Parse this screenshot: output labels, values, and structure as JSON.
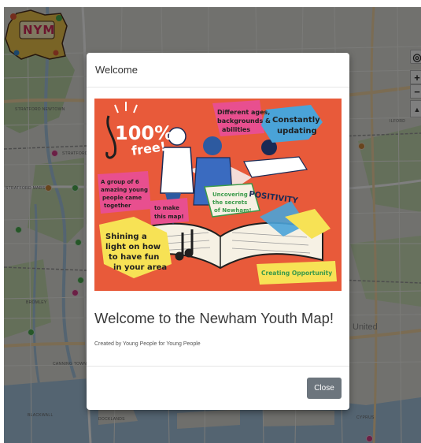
{
  "logo": {
    "text": "NYM"
  },
  "map": {
    "labels": {
      "stratford_newtown": "STRATFORD NEWTOWN",
      "stratford": "STRATFORD",
      "stratford_marsh": "STRATFORD MARSH",
      "bromley": "BROMLEY",
      "canning_town": "CANNING TOWN",
      "blackwall": "BLACKWALL",
      "docklands": "DOCKLANDS",
      "ilford": "ILFORD",
      "united": "United",
      "cyprus": "CYPRUS"
    },
    "controls": {
      "locate": "◎",
      "zoom_in": "+",
      "zoom_out": "−",
      "compass": "▲"
    },
    "marker_colors": {
      "pink": "#d63e8a",
      "green": "#4caf50",
      "orange": "#d08a3a"
    }
  },
  "modal": {
    "header_title": "Welcome",
    "heading": "Welcome to the Newham Youth Map!",
    "credit": "Created by Young People for Young People",
    "close_label": "Close"
  },
  "poster": {
    "bg_color": "#e85a3a",
    "texts": {
      "pct": "100%",
      "free": "free!",
      "ages_1": "Different ages,",
      "ages_2": "backgrounds &",
      "ages_3": "abilities",
      "const_1": "Constantly",
      "const_2": "updating",
      "group_1": "A group of 6",
      "group_2": "amazing young",
      "group_3": "people came",
      "group_4": "together",
      "make_1": "to make",
      "make_2": "this map!",
      "pos": "POSITIVITY",
      "unc_1": "Uncovering",
      "unc_2": "the secrets",
      "unc_3": "of Newham!",
      "shine_1": "Shining a",
      "shine_2": "light on how",
      "shine_3": "to have fun",
      "shine_4": "in your area",
      "opp": "Creating Opportunity"
    }
  }
}
